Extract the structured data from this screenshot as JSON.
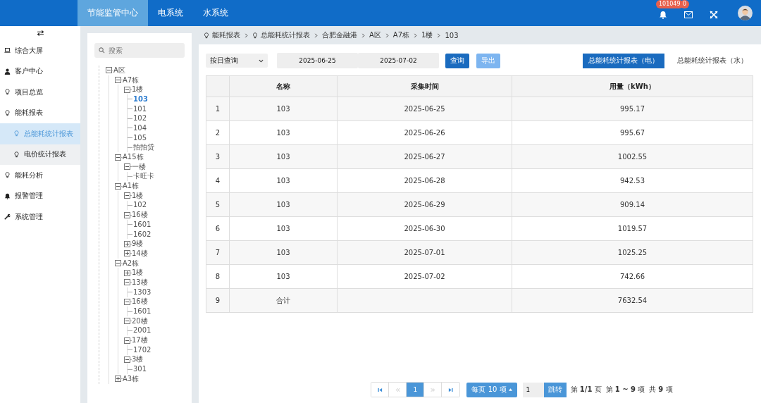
{
  "top_nav": {
    "tabs": [
      {
        "label": "节能监管中心",
        "selected": true
      },
      {
        "label": "电系统",
        "selected": false
      },
      {
        "label": "水系统",
        "selected": false
      }
    ],
    "notifications": {
      "badge": "101049"
    },
    "messages": {
      "badge": "0"
    }
  },
  "sidebar": {
    "items": [
      {
        "label": "综合大屏",
        "selected": false
      },
      {
        "label": "客户中心",
        "selected": false
      },
      {
        "label": "项目总览",
        "selected": false
      },
      {
        "label": "能耗报表",
        "selected": false,
        "children": [
          {
            "label": "总能耗统计报表",
            "selected": true
          },
          {
            "label": "电价统计报表",
            "selected": false
          }
        ]
      },
      {
        "label": "能耗分析",
        "selected": false
      },
      {
        "label": "报警管理",
        "selected": false
      },
      {
        "label": "系统管理",
        "selected": false
      }
    ]
  },
  "tree": {
    "search_placeholder": "搜索",
    "nodes": [
      {
        "label": "A区",
        "expanded": true,
        "children": [
          {
            "label": "A7栋",
            "expanded": true,
            "children": [
              {
                "label": "1楼",
                "expanded": true,
                "children": [
                  {
                    "label": "103",
                    "selected": true
                  },
                  {
                    "label": "101",
                    "selected": false
                  },
                  {
                    "label": "102",
                    "selected": false
                  },
                  {
                    "label": "104",
                    "selected": false
                  },
                  {
                    "label": "105",
                    "selected": false
                  },
                  {
                    "label": "拍拍贷",
                    "selected": false
                  }
                ]
              }
            ]
          },
          {
            "label": "A15栋",
            "expanded": true,
            "children": [
              {
                "label": "一楼",
                "expanded": true,
                "children": [
                  {
                    "label": "卡旺卡",
                    "selected": false
                  }
                ]
              }
            ]
          },
          {
            "label": "A1栋",
            "expanded": true,
            "children": [
              {
                "label": "1楼",
                "expanded": true,
                "children": [
                  {
                    "label": "102",
                    "selected": false
                  }
                ]
              },
              {
                "label": "16楼",
                "expanded": true,
                "children": [
                  {
                    "label": "1601",
                    "selected": false
                  },
                  {
                    "label": "1602",
                    "selected": false
                  }
                ]
              },
              {
                "label": "9楼",
                "expanded": false
              },
              {
                "label": "14楼",
                "expanded": false
              }
            ]
          },
          {
            "label": "A2栋",
            "expanded": true,
            "children": [
              {
                "label": "1楼",
                "expanded": false
              },
              {
                "label": "13楼",
                "expanded": true,
                "children": [
                  {
                    "label": "1303",
                    "selected": false
                  }
                ]
              },
              {
                "label": "16楼",
                "expanded": true,
                "children": [
                  {
                    "label": "1601",
                    "selected": false
                  }
                ]
              },
              {
                "label": "20楼",
                "expanded": true,
                "children": [
                  {
                    "label": "2001",
                    "selected": false
                  }
                ]
              },
              {
                "label": "17楼",
                "expanded": true,
                "children": [
                  {
                    "label": "1702",
                    "selected": false
                  }
                ]
              },
              {
                "label": "3楼",
                "expanded": true,
                "children": [
                  {
                    "label": "301",
                    "selected": false
                  }
                ]
              }
            ]
          },
          {
            "label": "A3栋",
            "expanded": false
          }
        ]
      }
    ]
  },
  "breadcrumb": [
    "能耗报表",
    "总能耗统计报表",
    "合肥金融港",
    "A区",
    "A7栋",
    "1楼",
    "103"
  ],
  "filters": {
    "mode": "按日查询",
    "start_date": "2025-06-25",
    "end_date": "2025-07-02",
    "query_button": "查询",
    "export_button": "导出",
    "export_disabled": true
  },
  "report_tabs": [
    {
      "label": "总能耗统计报表（电）",
      "selected": true
    },
    {
      "label": "总能耗统计报表（水）",
      "selected": false
    }
  ],
  "table": {
    "columns": [
      "名称",
      "采集时间",
      "用量（kWh）"
    ],
    "rows": [
      {
        "no": "1",
        "name": "103",
        "time": "2025-06-25",
        "value": "995.17"
      },
      {
        "no": "2",
        "name": "103",
        "time": "2025-06-26",
        "value": "995.67"
      },
      {
        "no": "3",
        "name": "103",
        "time": "2025-06-27",
        "value": "1002.55"
      },
      {
        "no": "4",
        "name": "103",
        "time": "2025-06-28",
        "value": "942.53"
      },
      {
        "no": "5",
        "name": "103",
        "time": "2025-06-29",
        "value": "909.14"
      },
      {
        "no": "6",
        "name": "103",
        "time": "2025-06-30",
        "value": "1019.57"
      },
      {
        "no": "7",
        "name": "103",
        "time": "2025-07-01",
        "value": "1025.25"
      },
      {
        "no": "8",
        "name": "103",
        "time": "2025-07-02",
        "value": "742.66"
      },
      {
        "no": "9",
        "name": "合计",
        "value": "7632.54"
      }
    ]
  },
  "pagination": {
    "current_page": "1",
    "page_size": "每页 10 项",
    "jump_value": "1",
    "jump_button": "跳转",
    "page_info": "第 **1/1** 页",
    "range_info": "第 **1 ~ 9** 项",
    "total_info": "共 **9** 项"
  }
}
